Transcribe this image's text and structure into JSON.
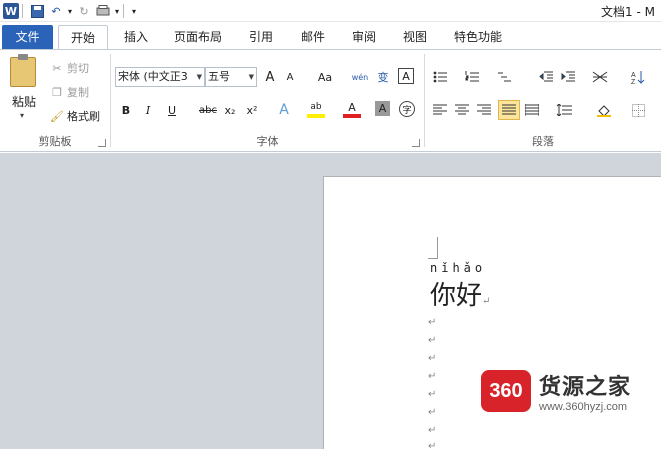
{
  "window": {
    "title": "文档1 - M"
  },
  "qat": {
    "undo_arrow": "▾",
    "qat_arrow": "▾",
    "more": "▾"
  },
  "tabs": [
    "文件",
    "开始",
    "插入",
    "页面布局",
    "引用",
    "邮件",
    "审阅",
    "视图",
    "特色功能"
  ],
  "clipboard": {
    "paste": "粘贴",
    "cut": "剪切",
    "copy": "复制",
    "format_painter": "格式刷",
    "group": "剪贴板",
    "paste_arrow": "▾"
  },
  "font": {
    "name": "宋体 (中文正3",
    "size": "五号",
    "group": "字体",
    "grow": "A",
    "shrink": "A",
    "case": "Aa",
    "pinyin_btn": "wén",
    "phonetic": "变",
    "border_char": "A",
    "bold": "B",
    "italic": "I",
    "underline": "U",
    "strike": "abc",
    "sub": "x₂",
    "sup": "x²",
    "effects": "A",
    "highlight": "ab",
    "color": "A",
    "shade": "A",
    "enclose": "字"
  },
  "paragraph": {
    "group": "段落"
  },
  "document": {
    "pinyin": "nǐhǎo",
    "text": "你好",
    "para_mark": "↵"
  },
  "watermark": {
    "logo": "360",
    "name": "货源之家",
    "url": "www.360hyzj.com"
  }
}
